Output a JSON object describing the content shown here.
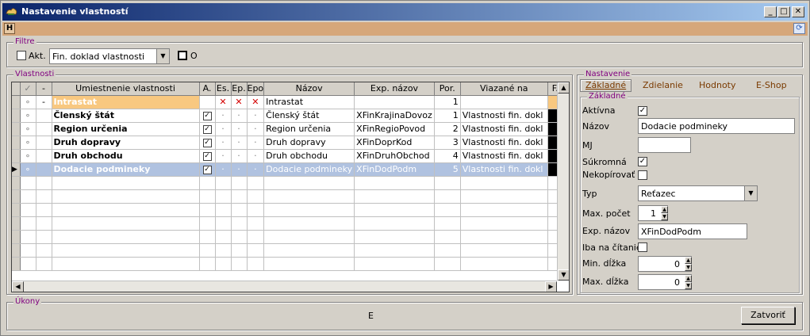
{
  "window": {
    "title": "Nastavenie vlastností",
    "min": "_",
    "max": "□",
    "close": "✕"
  },
  "toolbar": {
    "h_label": "H",
    "refresh_icon": "refresh-icon"
  },
  "filter": {
    "label": "Filtre",
    "akt_label": "Akt.",
    "akt_checked": false,
    "combo_value": "Fin. doklad vlastnosti",
    "o_label": "O",
    "o_checked": false
  },
  "grid": {
    "label": "Vlastnosti",
    "headers": [
      "",
      "✓",
      "-",
      "Umiestnenie vlastnosti",
      "A.",
      "Es.",
      "Ep.",
      "Epo",
      "Názov",
      "Exp. názov",
      "Por.",
      "Viazané na",
      "F."
    ],
    "rows": [
      {
        "check": "∘",
        "dash": "-",
        "location": "Intrastat",
        "a": "",
        "es": "✕",
        "ep": "✕",
        "epo": "✕",
        "name": "Intrastat",
        "exp": "",
        "por": "1",
        "bound": "",
        "f": ""
      },
      {
        "check": "∘",
        "dash": "",
        "location": "Členský štát",
        "a": "✓",
        "es": "·",
        "ep": "·",
        "epo": "·",
        "name": "Členský štát",
        "exp": "XFinKrajinaDovoz",
        "por": "1",
        "bound": "Vlastnosti fin. dokl",
        "f": ""
      },
      {
        "check": "∘",
        "dash": "",
        "location": "Region určenia",
        "a": "✓",
        "es": "·",
        "ep": "·",
        "epo": "·",
        "name": "Region určenia",
        "exp": "XFinRegioPovod",
        "por": "2",
        "bound": "Vlastnosti fin. dokl",
        "f": ""
      },
      {
        "check": "∘",
        "dash": "",
        "location": "Druh dopravy",
        "a": "✓",
        "es": "·",
        "ep": "·",
        "epo": "·",
        "name": "Druh dopravy",
        "exp": "XFinDoprKod",
        "por": "3",
        "bound": "Vlastnosti fin. dokl",
        "f": ""
      },
      {
        "check": "∘",
        "dash": "",
        "location": "Druh obchodu",
        "a": "✓",
        "es": "·",
        "ep": "·",
        "epo": "·",
        "name": "Druh obchodu",
        "exp": "XFinDruhObchod",
        "por": "4",
        "bound": "Vlastnosti fin. dokl",
        "f": ""
      },
      {
        "check": "∘",
        "dash": "",
        "location": "Dodacie podmineky",
        "a": "✓",
        "es": "·",
        "ep": "·",
        "epo": "·",
        "name": "Dodacie podmineky",
        "exp": "XFinDodPodm",
        "por": "5",
        "bound": "Vlastnosti fin. dokl",
        "f": ""
      }
    ]
  },
  "settings": {
    "label": "Nastavenie",
    "tabs": [
      "Základné",
      "Zdielanie",
      "Hodnoty",
      "E-Shop"
    ],
    "sub_label": "Základné",
    "aktivna_label": "Aktívna",
    "aktivna_checked": true,
    "nazov_label": "Názov",
    "nazov_value": "Dodacie podmineky",
    "mj_label": "MJ",
    "mj_value": "",
    "sukromna_label": "Súkromná",
    "sukromna_checked": true,
    "nekopirovat_label": "Nekopírovať",
    "nekopirovat_checked": false,
    "typ_label": "Typ",
    "typ_value": "Reťazec",
    "max_pocet_label": "Max. počet",
    "max_pocet_value": "1",
    "exp_nazov_label": "Exp. názov",
    "exp_nazov_value": "XFinDodPodm",
    "iba_label": "Iba na čítanie",
    "iba_checked": false,
    "min_dlzka_label": "Min. dĺžka",
    "min_dlzka_value": "0",
    "max_dlzka_label": "Max. dĺžka",
    "max_dlzka_value": "0"
  },
  "actions": {
    "label": "Úkony",
    "center_text": "E",
    "close_button": "Zatvoriť"
  }
}
